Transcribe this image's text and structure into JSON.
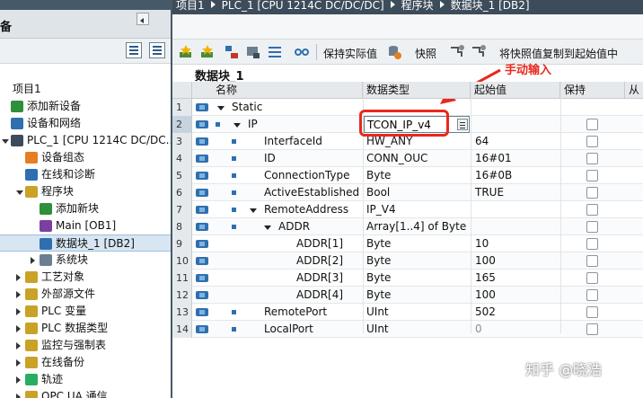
{
  "left": {
    "header_label": "备",
    "tree": [
      {
        "label": "项目1",
        "indent": 0,
        "icon": "none",
        "arrow": "none"
      },
      {
        "label": "添加新设备",
        "indent": 0,
        "icon": "add-device-icon",
        "arrow": "none"
      },
      {
        "label": "设备和网络",
        "indent": 0,
        "icon": "network-icon",
        "arrow": "none"
      },
      {
        "label": "PLC_1 [CPU 1214C DC/DC...",
        "indent": 0,
        "icon": "plc-icon",
        "arrow": "open"
      },
      {
        "label": "设备组态",
        "indent": 1,
        "icon": "device-config-icon",
        "arrow": "none"
      },
      {
        "label": "在线和诊断",
        "indent": 1,
        "icon": "diagnostics-icon",
        "arrow": "none"
      },
      {
        "label": "程序块",
        "indent": 1,
        "icon": "folder-icon",
        "arrow": "open"
      },
      {
        "label": "添加新块",
        "indent": 2,
        "icon": "add-block-icon",
        "arrow": "none"
      },
      {
        "label": "Main [OB1]",
        "indent": 2,
        "icon": "ob-block-icon",
        "arrow": "none"
      },
      {
        "label": "数据块_1 [DB2]",
        "indent": 2,
        "icon": "db-block-icon",
        "arrow": "none",
        "selected": true
      },
      {
        "label": "系统块",
        "indent": 2,
        "icon": "system-block-icon",
        "arrow": "closed"
      },
      {
        "label": "工艺对象",
        "indent": 1,
        "icon": "folder-icon",
        "arrow": "closed"
      },
      {
        "label": "外部源文件",
        "indent": 1,
        "icon": "folder-icon",
        "arrow": "closed"
      },
      {
        "label": "PLC 变量",
        "indent": 1,
        "icon": "folder-icon",
        "arrow": "closed"
      },
      {
        "label": "PLC 数据类型",
        "indent": 1,
        "icon": "folder-icon",
        "arrow": "closed"
      },
      {
        "label": "监控与强制表",
        "indent": 1,
        "icon": "folder-icon",
        "arrow": "closed"
      },
      {
        "label": "在线备份",
        "indent": 1,
        "icon": "folder-icon",
        "arrow": "closed"
      },
      {
        "label": "轨迹",
        "indent": 1,
        "icon": "trace-icon",
        "arrow": "closed"
      },
      {
        "label": "OPC UA 通信",
        "indent": 1,
        "icon": "folder-icon",
        "arrow": "closed"
      }
    ]
  },
  "breadcrumb": [
    "项目1",
    "PLC_1 [CPU 1214C DC/DC/DC]",
    "程序块",
    "数据块_1 [DB2]"
  ],
  "toolbar": {
    "keep_actual": "保持实际值",
    "snapshot": "快照",
    "copy_snapshot": "将快照值复制到起始值中"
  },
  "block_title": "数据块_1",
  "annotation": "手动输入",
  "columns": {
    "name": "名称",
    "datatype": "数据类型",
    "start": "起始值",
    "retain": "保持",
    "from": "从"
  },
  "rows": [
    {
      "num": "1",
      "name": "Static",
      "type": "",
      "start": "",
      "level": 0,
      "expand": true,
      "dot": false,
      "cb": false
    },
    {
      "num": "2",
      "name": "IP",
      "type": "TCON_IP_v4",
      "start": "",
      "level": 1,
      "expand": true,
      "dot": true,
      "cb": true,
      "current": true
    },
    {
      "num": "3",
      "name": "InterfaceId",
      "type": "HW_ANY",
      "start": "64",
      "level": 2,
      "expand": false,
      "dot": true,
      "cb": true
    },
    {
      "num": "4",
      "name": "ID",
      "type": "CONN_OUC",
      "start": "16#01",
      "level": 2,
      "expand": false,
      "dot": true,
      "cb": true
    },
    {
      "num": "5",
      "name": "ConnectionType",
      "type": "Byte",
      "start": "16#0B",
      "level": 2,
      "expand": false,
      "dot": true,
      "cb": true
    },
    {
      "num": "6",
      "name": "ActiveEstablished",
      "type": "Bool",
      "start": "TRUE",
      "level": 2,
      "expand": false,
      "dot": true,
      "cb": true
    },
    {
      "num": "7",
      "name": "RemoteAddress",
      "type": "IP_V4",
      "start": "",
      "level": 2,
      "expand": true,
      "dot": true,
      "cb": true
    },
    {
      "num": "8",
      "name": "ADDR",
      "type": "Array[1..4] of Byte",
      "start": "",
      "level": 3,
      "expand": true,
      "dot": true,
      "cb": true
    },
    {
      "num": "9",
      "name": "ADDR[1]",
      "type": "Byte",
      "start": "10",
      "level": 4,
      "expand": false,
      "dot": false,
      "cb": true
    },
    {
      "num": "10",
      "name": "ADDR[2]",
      "type": "Byte",
      "start": "100",
      "level": 4,
      "expand": false,
      "dot": false,
      "cb": true
    },
    {
      "num": "11",
      "name": "ADDR[3]",
      "type": "Byte",
      "start": "165",
      "level": 4,
      "expand": false,
      "dot": false,
      "cb": true
    },
    {
      "num": "12",
      "name": "ADDR[4]",
      "type": "Byte",
      "start": "100",
      "level": 4,
      "expand": false,
      "dot": false,
      "cb": true
    },
    {
      "num": "13",
      "name": "RemotePort",
      "type": "UInt",
      "start": "502",
      "level": 2,
      "expand": false,
      "dot": true,
      "cb": true
    },
    {
      "num": "14",
      "name": "LocalPort",
      "type": "UInt",
      "start": "0",
      "level": 2,
      "expand": false,
      "dot": true,
      "cb": true,
      "muted": true
    }
  ],
  "watermark": "知乎 @晓浩",
  "colors": {
    "accent": "#2f6fb0",
    "annotation": "#e8291c",
    "titlebar": "#3d4c5a"
  }
}
